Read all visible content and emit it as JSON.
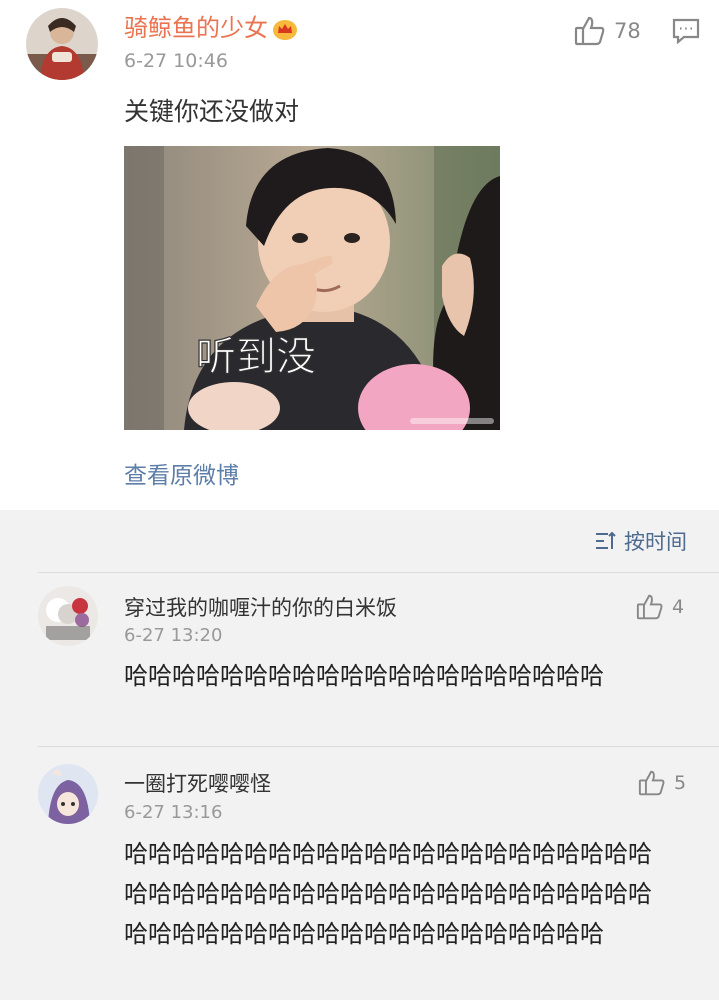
{
  "post": {
    "author": "骑鲸鱼的少女",
    "time": "6-27 10:46",
    "likes": "78",
    "text": "关键你还没做对",
    "image_caption": "听到没",
    "view_original": "查看原微博"
  },
  "comments_header": {
    "sort_label": "按时间"
  },
  "comments": [
    {
      "author": "穿过我的咖喱汁的你的白米饭",
      "time": "6-27 13:20",
      "likes": "4",
      "text": "哈哈哈哈哈哈哈哈哈哈哈哈哈哈哈哈哈哈哈哈"
    },
    {
      "author": "一圈打死嘤嘤怪",
      "time": "6-27 13:16",
      "likes": "5",
      "text": "哈哈哈哈哈哈哈哈哈哈哈哈哈哈哈哈哈哈哈哈哈哈哈哈哈哈哈哈哈哈哈哈哈哈哈哈哈哈哈哈哈哈哈哈哈哈哈哈哈哈哈哈哈哈哈哈哈哈哈哈哈哈哈哈"
    }
  ],
  "colors": {
    "author_orange": "#eb7350",
    "link_blue": "#5d7ea8",
    "page_gray": "#f2f2f2"
  }
}
